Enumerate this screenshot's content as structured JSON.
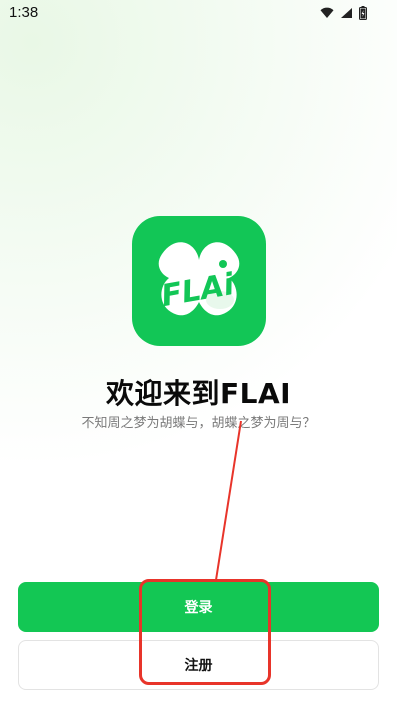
{
  "status_bar": {
    "time": "1:38",
    "icons": [
      "wifi-icon",
      "signal-icon",
      "battery-icon"
    ]
  },
  "logo": {
    "text": "FLAi",
    "brand_color": "#12c656"
  },
  "welcome": {
    "title": "欢迎来到FLAI",
    "subtitle": "不知周之梦为胡蝶与，胡蝶之梦为周与？"
  },
  "buttons": {
    "login_label": "登录",
    "register_label": "注册"
  },
  "annotation": {
    "color": "#e8342a"
  },
  "colors": {
    "accent": "#13c754",
    "title": "#0a0a0a",
    "subtitle": "#7a7a7a"
  }
}
